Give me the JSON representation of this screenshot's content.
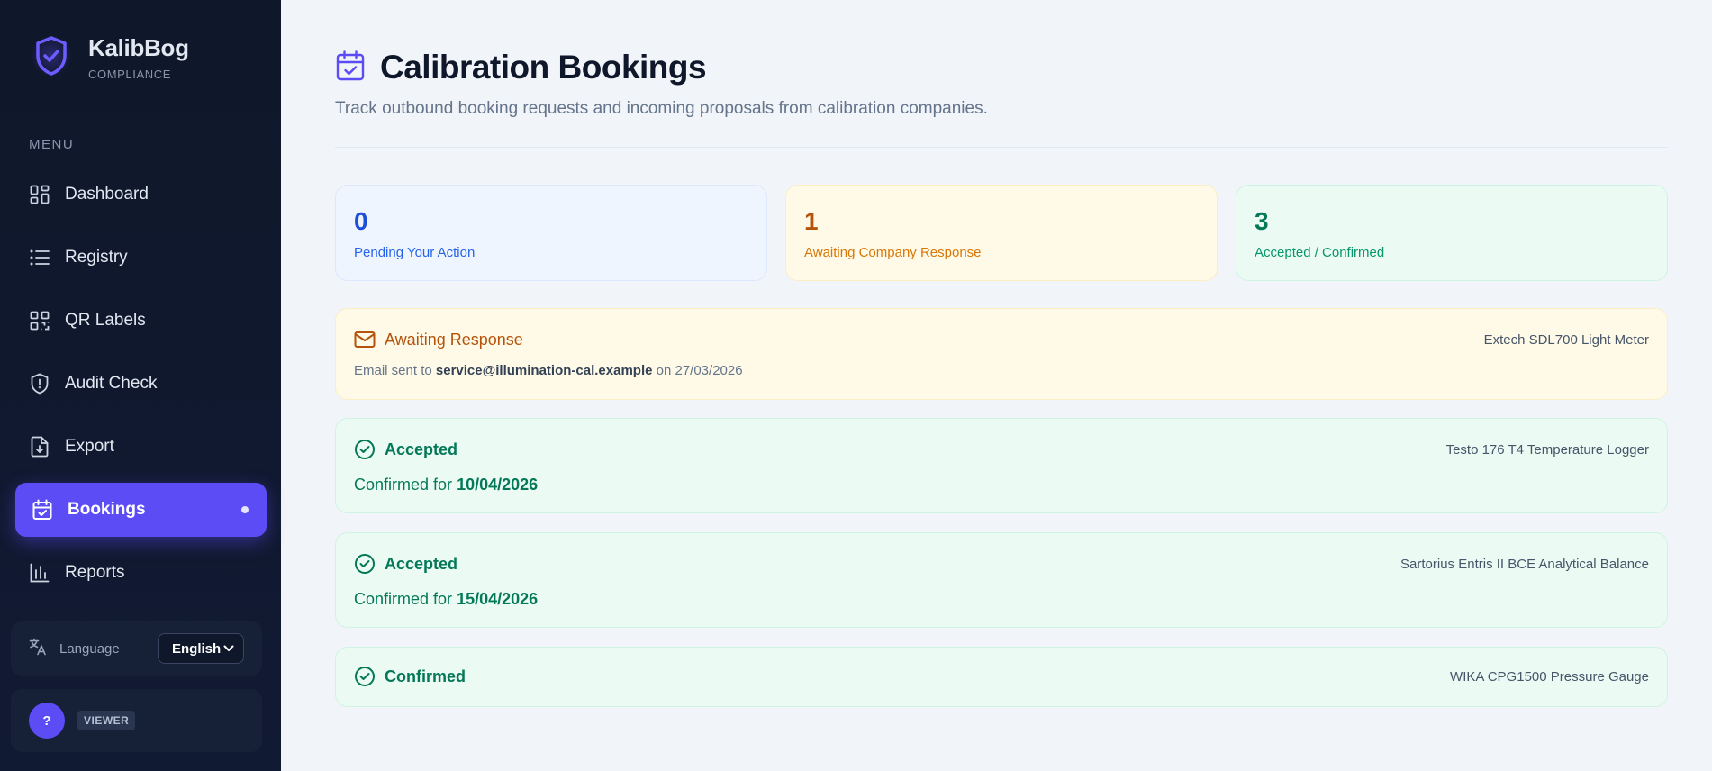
{
  "brand": {
    "name": "KalibBog",
    "subtitle": "COMPLIANCE"
  },
  "sidebar": {
    "menu_heading": "MENU",
    "items": [
      {
        "label": "Dashboard",
        "icon": "dashboard-icon"
      },
      {
        "label": "Registry",
        "icon": "list-icon"
      },
      {
        "label": "QR Labels",
        "icon": "qr-code-icon"
      },
      {
        "label": "Audit Check",
        "icon": "shield-alert-icon"
      },
      {
        "label": "Export",
        "icon": "file-download-icon"
      },
      {
        "label": "Bookings",
        "icon": "calendar-check-icon",
        "active": true
      },
      {
        "label": "Reports",
        "icon": "bar-chart-icon"
      }
    ],
    "language": {
      "label": "Language",
      "selected": "English"
    },
    "user": {
      "avatar": "?",
      "role": "VIEWER"
    }
  },
  "header": {
    "title": "Calibration Bookings",
    "subtitle": "Track outbound booking requests and incoming proposals from calibration companies."
  },
  "stats": [
    {
      "value": "0",
      "label": "Pending Your Action",
      "color": "#1d4ed8"
    },
    {
      "value": "1",
      "label": "Awaiting Company Response",
      "color": "#b45309"
    },
    {
      "value": "3",
      "label": "Accepted / Confirmed",
      "color": "#047857"
    }
  ],
  "bookings": [
    {
      "status": "Awaiting Response",
      "device": "Extech SDL700 Light Meter",
      "meta_prefix": "Email sent to",
      "email": "service@illumination-cal.example",
      "meta_on": "on",
      "sent_date": "27/03/2026"
    },
    {
      "status": "Accepted",
      "device": "Testo 176 T4 Temperature Logger",
      "confirm_prefix": "Confirmed for",
      "confirm_date": "10/04/2026"
    },
    {
      "status": "Accepted",
      "device": "Sartorius Entris II BCE Analytical Balance",
      "confirm_prefix": "Confirmed for",
      "confirm_date": "15/04/2026"
    },
    {
      "status": "Confirmed",
      "device": "WIKA CPG1500 Pressure Gauge"
    }
  ],
  "colors": {
    "accent": "#5b4cf5",
    "sidebar_bg": "#0f172a",
    "amber": "#b45309",
    "green": "#047857",
    "blue": "#1d4ed8"
  }
}
